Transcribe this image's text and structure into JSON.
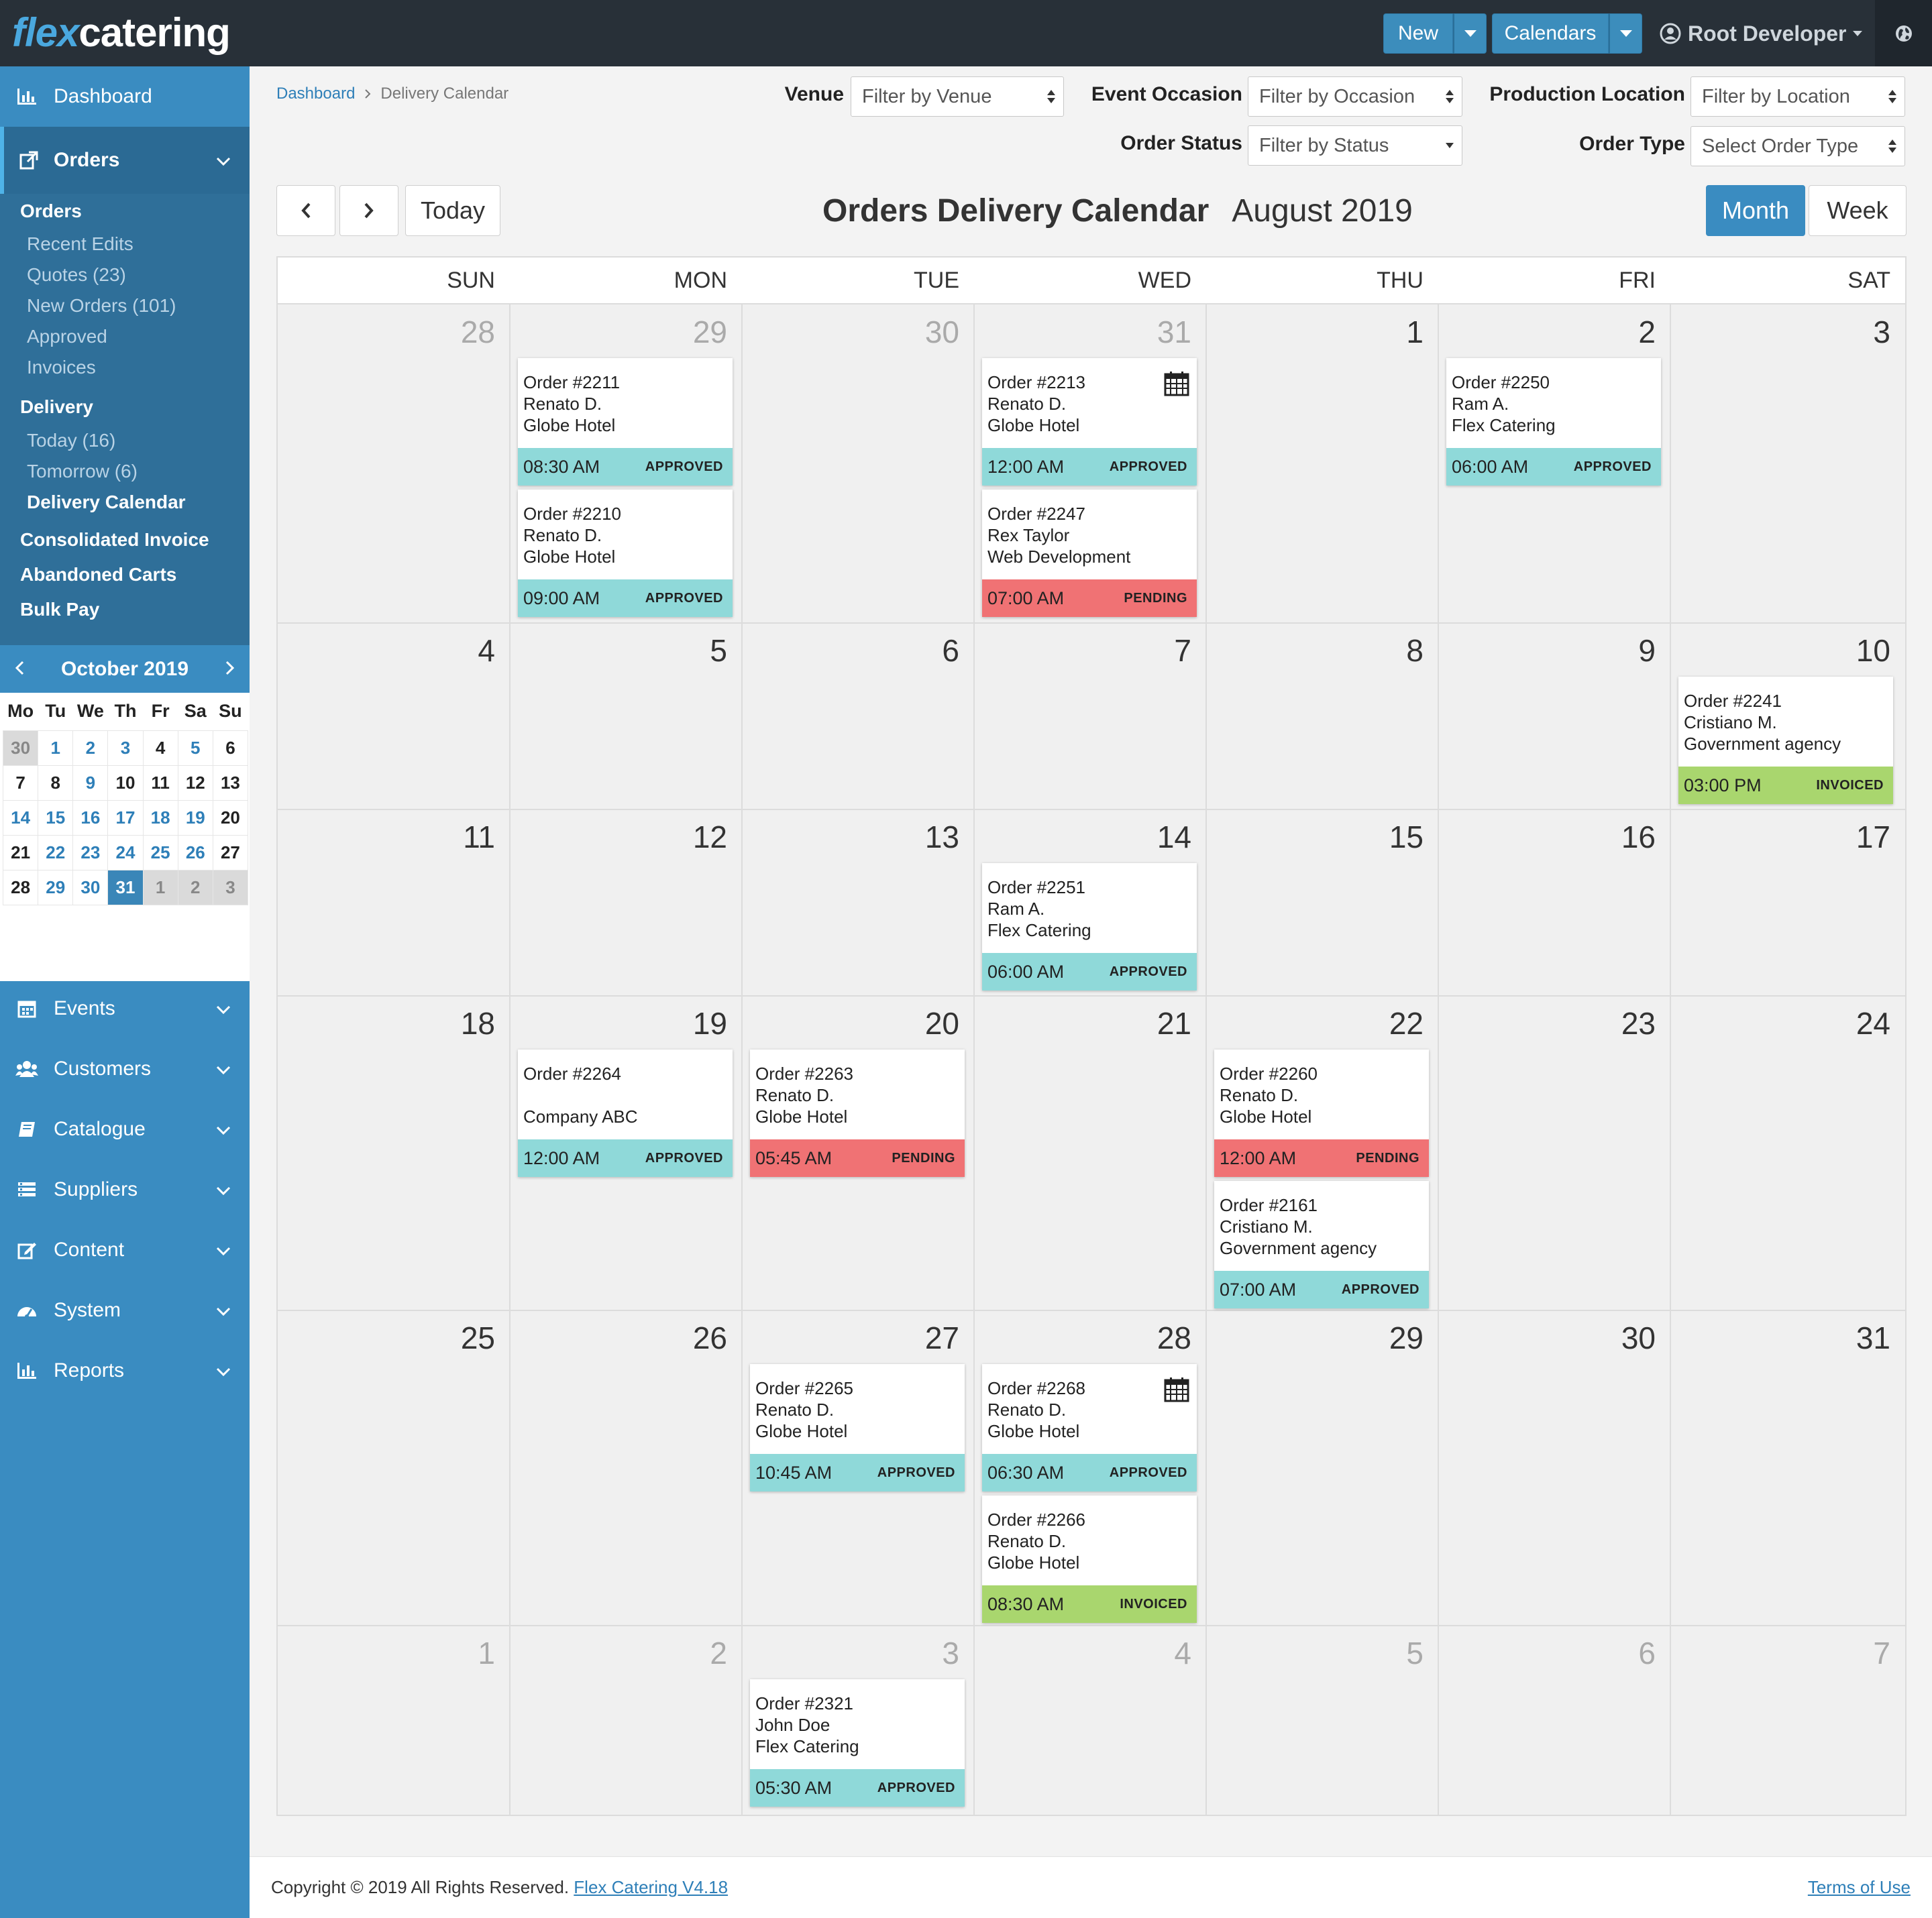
{
  "header": {
    "logo_part1": "flex",
    "logo_part2": "catering",
    "new_label": "New",
    "calendars_label": "Calendars",
    "user_name": "Root Developer"
  },
  "sidebar": {
    "dashboard": "Dashboard",
    "orders": "Orders",
    "orders_sub": {
      "heading": "Orders",
      "recent_edits": "Recent Edits",
      "quotes": "Quotes (23)",
      "new_orders": "New Orders (101)",
      "approved": "Approved",
      "invoices": "Invoices",
      "delivery_heading": "Delivery",
      "today": "Today (16)",
      "tomorrow": "Tomorrow (6)",
      "delivery_calendar": "Delivery Calendar",
      "consolidated_invoice": "Consolidated Invoice",
      "abandoned_carts": "Abandoned Carts",
      "bulk_pay": "Bulk Pay"
    },
    "menu": {
      "events": "Events",
      "customers": "Customers",
      "catalogue": "Catalogue",
      "suppliers": "Suppliers",
      "content": "Content",
      "system": "System",
      "reports": "Reports"
    }
  },
  "mini_calendar": {
    "title": "October 2019",
    "weekdays": [
      "Mo",
      "Tu",
      "We",
      "Th",
      "Fr",
      "Sa",
      "Su"
    ],
    "weeks": [
      [
        "30",
        "1",
        "2",
        "3",
        "4",
        "5",
        "6"
      ],
      [
        "7",
        "8",
        "9",
        "10",
        "11",
        "12",
        "13"
      ],
      [
        "14",
        "15",
        "16",
        "17",
        "18",
        "19",
        "20"
      ],
      [
        "21",
        "22",
        "23",
        "24",
        "25",
        "26",
        "27"
      ],
      [
        "28",
        "29",
        "30",
        "31",
        "1",
        "2",
        "3"
      ]
    ]
  },
  "breadcrumb": {
    "home": "Dashboard",
    "current": "Delivery Calendar"
  },
  "filters": {
    "venue_label": "Venue",
    "venue_placeholder": "Filter by Venue",
    "occasion_label": "Event Occasion",
    "occasion_placeholder": "Filter by Occasion",
    "location_label": "Production Location",
    "location_placeholder": "Filter by Location",
    "status_label": "Order Status",
    "status_placeholder": "Filter by Status",
    "type_label": "Order Type",
    "type_placeholder": "Select Order Type"
  },
  "calendar": {
    "today_label": "Today",
    "title": "Orders Delivery Calendar",
    "period": "August 2019",
    "month_label": "Month",
    "week_label": "Week",
    "weekdays": [
      "SUN",
      "MON",
      "TUE",
      "WED",
      "THU",
      "FRI",
      "SAT"
    ],
    "weeks": [
      [
        "28",
        "29",
        "30",
        "31",
        "1",
        "2",
        "3"
      ],
      [
        "4",
        "5",
        "6",
        "7",
        "8",
        "9",
        "10"
      ],
      [
        "11",
        "12",
        "13",
        "14",
        "15",
        "16",
        "17"
      ],
      [
        "18",
        "19",
        "20",
        "21",
        "22",
        "23",
        "24"
      ],
      [
        "25",
        "26",
        "27",
        "28",
        "29",
        "30",
        "31"
      ],
      [
        "1",
        "2",
        "3",
        "4",
        "5",
        "6",
        "7"
      ]
    ],
    "events": [
      {
        "week": 0,
        "day": 1,
        "slot": 0,
        "order": "Order #2211",
        "customer": "Renato D.",
        "company": "Globe Hotel",
        "time": "08:30 AM",
        "status": "APPROVED",
        "icon": false
      },
      {
        "week": 0,
        "day": 1,
        "slot": 1,
        "order": "Order #2210",
        "customer": "Renato D.",
        "company": "Globe Hotel",
        "time": "09:00 AM",
        "status": "APPROVED",
        "icon": false
      },
      {
        "week": 0,
        "day": 3,
        "slot": 0,
        "order": "Order #2213",
        "customer": "Renato D.",
        "company": "Globe Hotel",
        "time": "12:00 AM",
        "status": "APPROVED",
        "icon": true
      },
      {
        "week": 0,
        "day": 3,
        "slot": 1,
        "order": "Order #2247",
        "customer": "Rex Taylor",
        "company": "Web Development",
        "time": "07:00 AM",
        "status": "PENDING",
        "icon": false
      },
      {
        "week": 0,
        "day": 5,
        "slot": 0,
        "order": "Order #2250",
        "customer": "Ram A.",
        "company": "Flex Catering",
        "time": "06:00 AM",
        "status": "APPROVED",
        "icon": false
      },
      {
        "week": 1,
        "day": 6,
        "slot": 0,
        "order": "Order #2241",
        "customer": "Cristiano M.",
        "company": "Government agency",
        "time": "03:00 PM",
        "status": "INVOICED",
        "icon": false
      },
      {
        "week": 2,
        "day": 3,
        "slot": 0,
        "order": "Order #2251",
        "customer": "Ram A.",
        "company": "Flex Catering",
        "time": "06:00 AM",
        "status": "APPROVED",
        "icon": false
      },
      {
        "week": 3,
        "day": 1,
        "slot": 0,
        "order": "Order #2264",
        "customer": "",
        "company": "Company ABC",
        "time": "12:00 AM",
        "status": "APPROVED",
        "icon": false
      },
      {
        "week": 3,
        "day": 2,
        "slot": 0,
        "order": "Order #2263",
        "customer": "Renato D.",
        "company": "Globe Hotel",
        "time": "05:45 AM",
        "status": "PENDING",
        "icon": false
      },
      {
        "week": 3,
        "day": 4,
        "slot": 0,
        "order": "Order #2260",
        "customer": "Renato D.",
        "company": "Globe Hotel",
        "time": "12:00 AM",
        "status": "PENDING",
        "icon": false
      },
      {
        "week": 3,
        "day": 4,
        "slot": 1,
        "order": "Order #2161",
        "customer": "Cristiano M.",
        "company": "Government agency",
        "time": "07:00 AM",
        "status": "APPROVED",
        "icon": false
      },
      {
        "week": 4,
        "day": 2,
        "slot": 0,
        "order": "Order #2265",
        "customer": "Renato D.",
        "company": "Globe Hotel",
        "time": "10:45 AM",
        "status": "APPROVED",
        "icon": false
      },
      {
        "week": 4,
        "day": 3,
        "slot": 0,
        "order": "Order #2268",
        "customer": "Renato D.",
        "company": "Globe Hotel",
        "time": "06:30 AM",
        "status": "APPROVED",
        "icon": true
      },
      {
        "week": 4,
        "day": 3,
        "slot": 1,
        "order": "Order #2266",
        "customer": "Renato D.",
        "company": "Globe Hotel",
        "time": "08:30 AM",
        "status": "INVOICED",
        "icon": false
      },
      {
        "week": 5,
        "day": 2,
        "slot": 0,
        "order": "Order #2321",
        "customer": "John Doe",
        "company": "Flex Catering",
        "time": "05:30 AM",
        "status": "APPROVED",
        "icon": false
      }
    ]
  },
  "status_colors": {
    "APPROVED": "#8fd9d9",
    "PENDING": "#f07274",
    "INVOICED": "#a9d66e"
  },
  "footer": {
    "copyright": "Copyright © 2019 All Rights Reserved.",
    "version_link": "Flex Catering V4.18",
    "terms": "Terms of Use"
  }
}
